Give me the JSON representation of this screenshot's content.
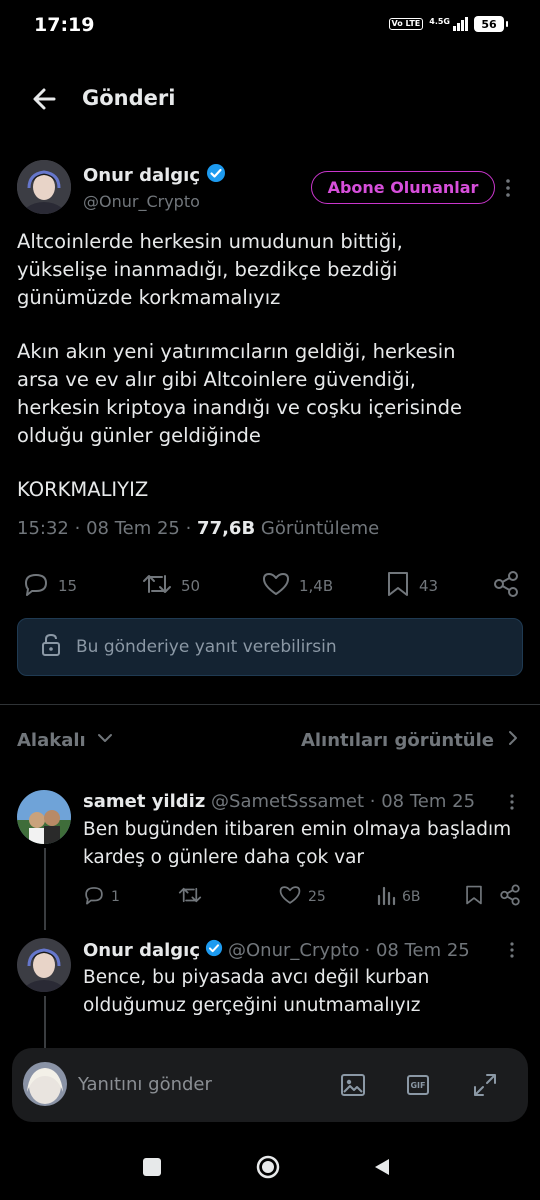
{
  "status_bar": {
    "time": "17:19",
    "network": "4.5G",
    "volte": "Vo LTE",
    "battery": "56"
  },
  "header": {
    "title": "Gönderi"
  },
  "post": {
    "author_name": "Onur dalgıç",
    "author_handle": "@Onur_Crypto",
    "subscribe_label": "Abone Olunanlar",
    "text_1": "Altcoinlerde herkesin umudunun bittiği,\nyükselişe inanmadığı, bezdikçe bezdiği\ngünümüzde korkmamalıyız",
    "text_2": "Akın akın yeni yatırımcıların geldiği, herkesin\narsa ve ev alır gibi Altcoinlere güvendiği,\nherkesin kriptoya inandığı ve coşku içerisinde\nolduğu günler geldiğinde",
    "text_3": "KORKMALIYIZ",
    "time": "15:32",
    "date": "08 Tem 25",
    "views": "77,6B",
    "views_label": "Görüntüleme",
    "replies": "15",
    "reposts": "50",
    "likes": "1,4B",
    "bookmarks": "43"
  },
  "reply_restriction": "Bu gönderiye yanıt verebilirsin",
  "sort": {
    "label": "Alakalı",
    "quotes_label": "Alıntıları görüntüle"
  },
  "replies": [
    {
      "name": "samet yildiz",
      "handle": "@SametSssamet",
      "date": "· 08 Tem 25",
      "text": "Ben bugünden itibaren emin olmaya başladım\nkardeş o günlere daha çok var",
      "replies": "1",
      "reposts": "",
      "likes": "25",
      "views": "6B"
    },
    {
      "name": "Onur dalgıç",
      "handle": "@Onur_Crypto",
      "date": "· 08 Tem 25",
      "text": "Bence, bu piyasada avcı değil kurban\nolduğumuz gerçeğini unutmamalıyız"
    }
  ],
  "composer": {
    "placeholder": "Yanıtını gönder",
    "gif_label": "GIF"
  },
  "colors": {
    "accent": "#1d9bf0",
    "subscribe": "#c936cc",
    "muted": "#71767b",
    "background": "#000000"
  }
}
